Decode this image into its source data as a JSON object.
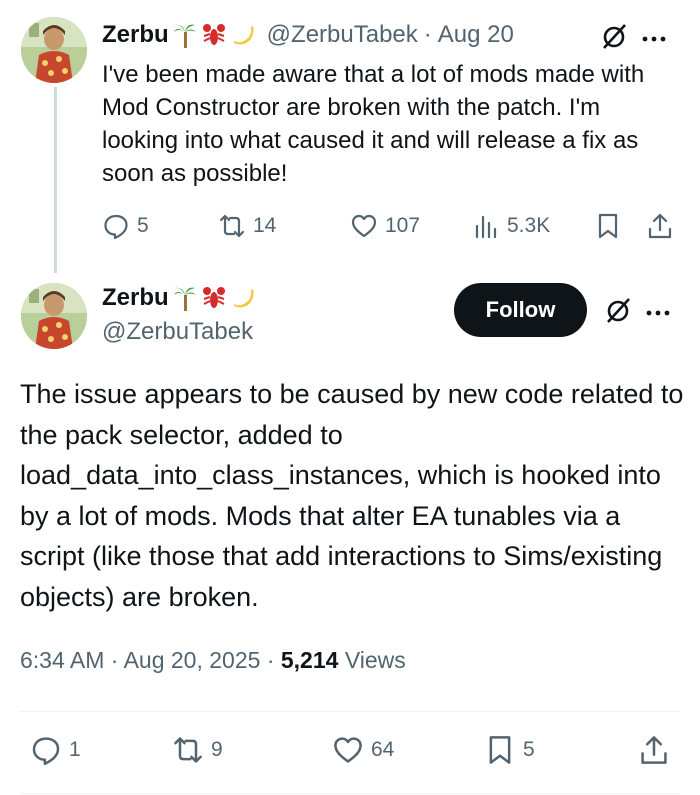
{
  "tweet1": {
    "author_name": "Zerbu",
    "handle": "@ZerbuTabek",
    "separator": "·",
    "date": "Aug 20",
    "text": "I've been made aware that a lot of mods made with Mod Constructor are broken with the patch. I'm looking into what caused it and will release a fix as soon as possible!",
    "stats": {
      "replies": "5",
      "reposts": "14",
      "likes": "107",
      "views": "5.3K"
    },
    "icons": [
      "grok-icon",
      "more-icon",
      "reply-icon",
      "repost-icon",
      "like-icon",
      "views-icon",
      "bookmark-icon",
      "share-icon"
    ]
  },
  "tweet2": {
    "author_name": "Zerbu",
    "handle": "@ZerbuTabek",
    "follow_label": "Follow",
    "text": "The issue appears to be caused by new code related to the pack selector, added to load_data_into_class_instances, which is hooked into by a lot of mods. Mods that alter EA tunables via a script (like those that add interactions to Sims/existing objects) are broken.",
    "time": "6:34 AM",
    "separator": "·",
    "date": "Aug 20, 2025",
    "views_count": "5,214",
    "views_label": "Views",
    "stats": {
      "replies": "1",
      "reposts": "9",
      "likes": "64",
      "bookmarks": "5"
    }
  },
  "name_emojis": [
    "palm-tree-emoji",
    "lobster-emoji",
    "banana-emoji"
  ],
  "colors": {
    "text": "#0f1419",
    "secondary": "#536471",
    "follow_bg": "#0f1419",
    "thread_line": "#cfd9de"
  }
}
